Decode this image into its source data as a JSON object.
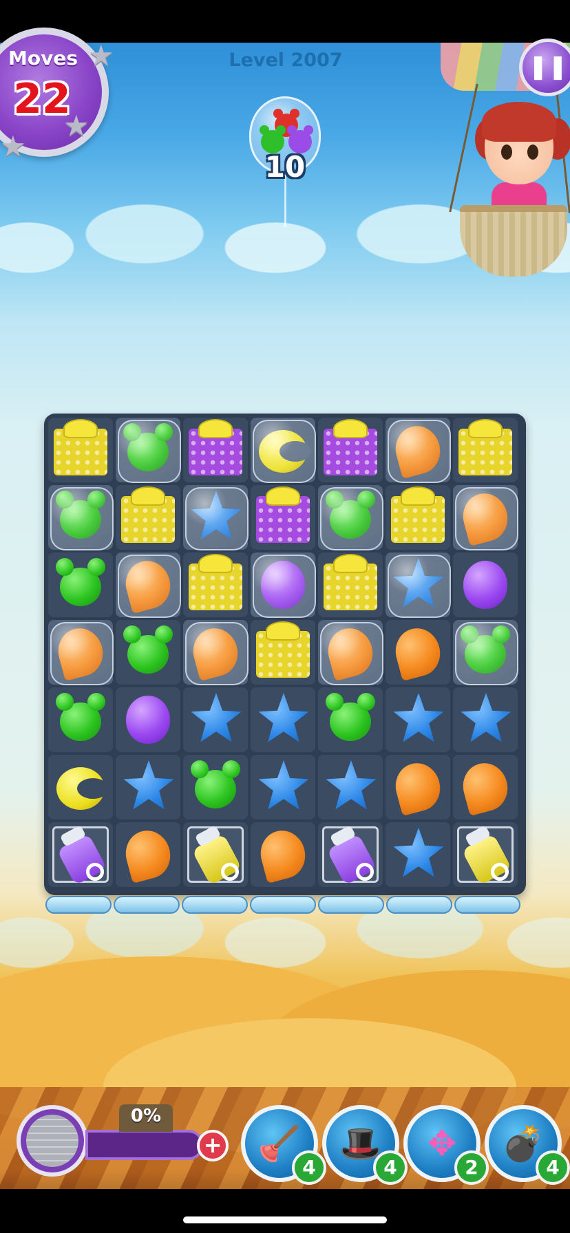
{
  "hud": {
    "moves_label": "Moves",
    "moves_value": "22",
    "level_label": "Level 2007",
    "goal_count": "10",
    "progress_percent": "0%",
    "progress_fraction": 0
  },
  "board": {
    "rows": 7,
    "cols": 7,
    "cells": [
      [
        "gift-yellow",
        "bubble:bear-green",
        "gift-purple",
        "bubble:moon-yellow",
        "gift-purple",
        "bubble:balloon-orange",
        "gift-yellow"
      ],
      [
        "bubble:bear-green",
        "gift-yellow",
        "bubble:star-blue",
        "gift-purple",
        "bubble:bear-green",
        "gift-yellow",
        "bubble:balloon-orange"
      ],
      [
        "bear-green",
        "bubble:balloon-orange",
        "gift-yellow",
        "bubble:balloon-purple",
        "gift-yellow",
        "bubble:star-blue",
        "balloon-purple"
      ],
      [
        "bubble:balloon-orange",
        "bear-green",
        "bubble:balloon-orange",
        "gift-yellow",
        "bubble:balloon-orange",
        "balloon-orange",
        "bubble:bear-green"
      ],
      [
        "bear-green",
        "balloon-purple",
        "star-blue",
        "star-blue",
        "bear-green",
        "star-blue",
        "star-blue"
      ],
      [
        "moon-yellow",
        "star-blue",
        "bear-green",
        "star-blue",
        "star-blue",
        "balloon-orange",
        "balloon-orange"
      ],
      [
        "canister-purple",
        "balloon-orange",
        "canister-yellow",
        "balloon-orange",
        "canister-purple",
        "star-blue",
        "canister-yellow"
      ]
    ]
  },
  "boosters": [
    {
      "name": "plunger-icon",
      "count": "4"
    },
    {
      "name": "hat-icon",
      "count": "4"
    },
    {
      "name": "arrows-icon",
      "count": "2"
    },
    {
      "name": "bomb-icon",
      "count": "4"
    }
  ],
  "colors": {
    "moves_badge": "#8a45c8",
    "moves_value": "#e3141b",
    "level_text": "#1e6fae",
    "booster_count": "#29a835",
    "add_button": "#e23a4d"
  }
}
